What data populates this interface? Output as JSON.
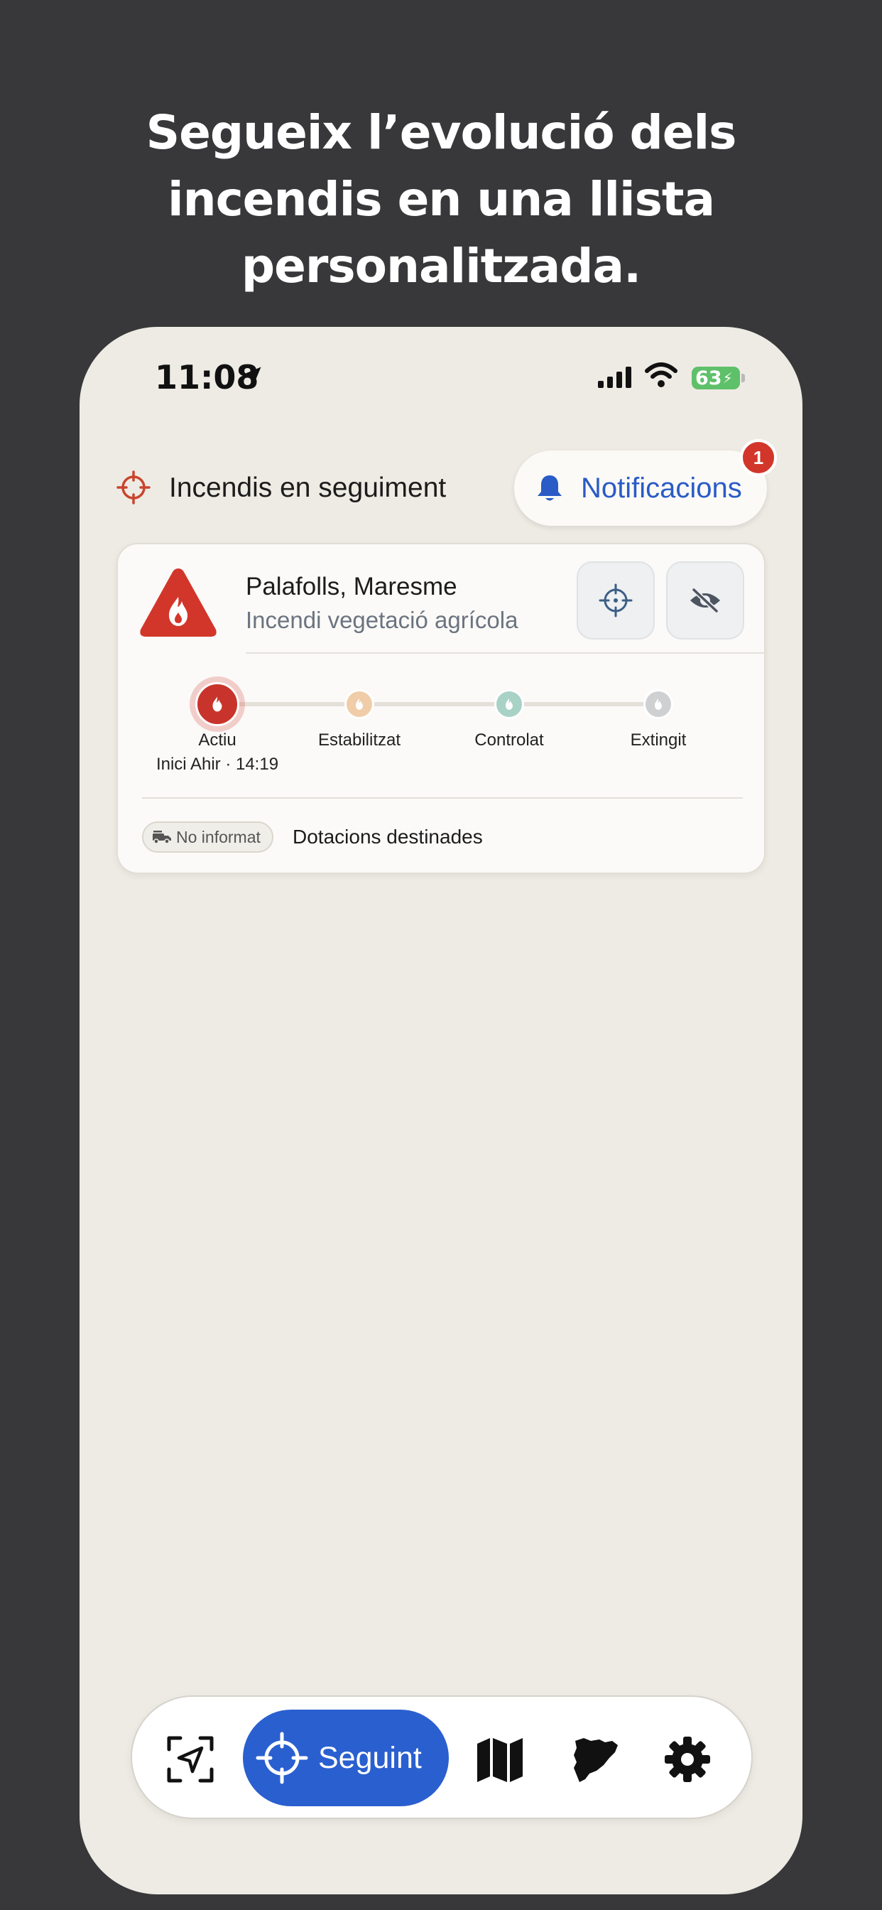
{
  "headline": {
    "line1": "Segueix l’evolució dels",
    "line2": "incendis en una llista",
    "line3": "personalitzada."
  },
  "status_bar": {
    "time": "11:08",
    "battery": "63"
  },
  "header": {
    "title": "Incendis en seguiment",
    "notifications_label": "Notificacions",
    "notifications_count": "1"
  },
  "incident": {
    "location": "Palafolls, Maresme",
    "type": "Incendi vegetació agrícola",
    "steps": [
      {
        "label": "Actiu",
        "sub": "Inici Ahir · 14:19",
        "color": "#c8342b"
      },
      {
        "label": "Estabilitzat",
        "color": "#f0cda8"
      },
      {
        "label": "Controlat",
        "color": "#a8d2c6"
      },
      {
        "label": "Extingit",
        "color": "#cfd0d1"
      }
    ],
    "chip_label": "No informat",
    "resources_label": "Dotacions destinades"
  },
  "nav": {
    "active_label": "Seguint"
  },
  "colors": {
    "accent_blue": "#2a5fcf",
    "fire_red": "#d2362a",
    "background": "#eeebe4"
  }
}
